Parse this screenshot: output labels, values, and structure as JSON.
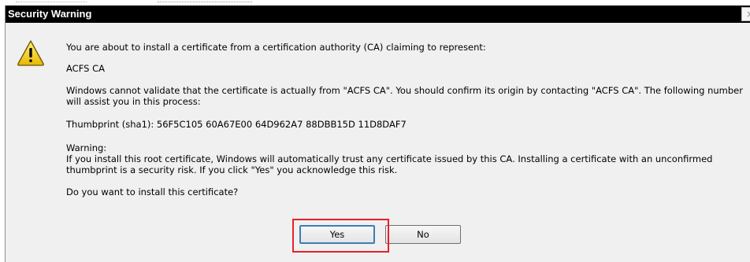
{
  "dialog": {
    "title": "Security Warning",
    "close_label": "×",
    "icon": "warning-triangle-icon",
    "line1": "You are about to install a certificate from a certification authority (CA) claiming to represent:",
    "ca_name": "ACFS CA",
    "validate_text": "Windows cannot validate that the certificate is actually from \"ACFS CA\". You should confirm its origin by contacting \"ACFS CA\". The following number will assist you in this process:",
    "thumbprint": "Thumbprint (sha1): 56F5C105 60A67E00 64D962A7 88DBB15D 11D8DAF7",
    "warning_heading": "Warning:",
    "warning_text": "If you install this root certificate, Windows will automatically trust any certificate issued by this CA. Installing a certificate with an unconfirmed thumbprint is a security risk. If you click \"Yes\" you acknowledge this risk.",
    "question": "Do you want to install this certificate?",
    "yes_label": "Yes",
    "no_label": "No"
  },
  "colors": {
    "titlebar": "#000000",
    "dialog_bg": "#f0f0f0",
    "highlight": "#e8202a",
    "warning_fill": "#f5d000"
  }
}
